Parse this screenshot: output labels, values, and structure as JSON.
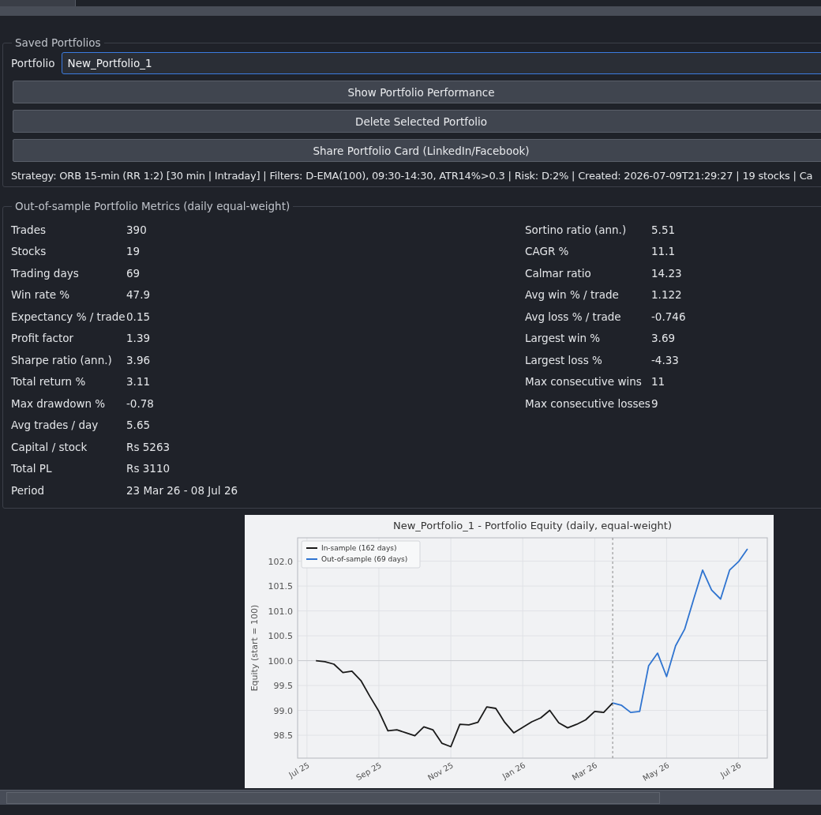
{
  "saved_portfolios": {
    "title": "Saved Portfolios",
    "portfolio_label": "Portfolio",
    "portfolio_value": "New_Portfolio_1",
    "buttons": [
      "Show Portfolio Performance",
      "Delete Selected Portfolio",
      "Share Portfolio Card (LinkedIn/Facebook)"
    ],
    "strategy_line": "Strategy: ORB 15-min (RR 1:2) [30 min | Intraday] | Filters: D-EMA(100), 09:30-14:30, ATR14%>0.3 | Risk: D:2% | Created: 2026-07-09T21:29:27 | 19 stocks | Ca"
  },
  "metrics": {
    "title": "Out-of-sample Portfolio Metrics (daily equal-weight)",
    "left": [
      {
        "label": "Trades",
        "value": "390"
      },
      {
        "label": "Stocks",
        "value": "19"
      },
      {
        "label": "Trading days",
        "value": "69"
      },
      {
        "label": "Win rate %",
        "value": "47.9"
      },
      {
        "label": "Expectancy % / trade",
        "value": "0.15"
      },
      {
        "label": "Profit factor",
        "value": "1.39"
      },
      {
        "label": "Sharpe ratio (ann.)",
        "value": "3.96"
      },
      {
        "label": "Total return %",
        "value": "3.11"
      },
      {
        "label": "Max drawdown %",
        "value": "-0.78"
      },
      {
        "label": "Avg trades / day",
        "value": "5.65"
      },
      {
        "label": "Capital / stock",
        "value": "Rs 5263"
      },
      {
        "label": "Total PL",
        "value": "Rs 3110"
      },
      {
        "label": "Period",
        "value": "23 Mar 26 - 08 Jul 26"
      }
    ],
    "right": [
      {
        "label": "Sortino ratio (ann.)",
        "value": "5.51"
      },
      {
        "label": "CAGR %",
        "value": "11.1"
      },
      {
        "label": "Calmar ratio",
        "value": "14.23"
      },
      {
        "label": "Avg win % / trade",
        "value": "1.122"
      },
      {
        "label": "Avg loss % / trade",
        "value": "-0.746"
      },
      {
        "label": "Largest win %",
        "value": "3.69"
      },
      {
        "label": "Largest loss %",
        "value": "-4.33"
      },
      {
        "label": "Max consecutive wins",
        "value": "11"
      },
      {
        "label": "Max consecutive losses",
        "value": "9"
      }
    ]
  },
  "equity_chart": {
    "chart_data": {
      "type": "line",
      "title": "New_Portfolio_1 - Portfolio Equity (daily, equal-weight)",
      "ylabel": "Equity (start = 100)",
      "grid": true,
      "legend": "upper left",
      "ylim": [
        98.04,
        102.47
      ],
      "categories": [
        "Jul 25",
        null,
        null,
        null,
        null,
        null,
        null,
        null,
        "Sep 25",
        null,
        null,
        null,
        null,
        null,
        null,
        null,
        "Nov 25",
        null,
        null,
        null,
        null,
        null,
        null,
        null,
        "Jan 26",
        null,
        null,
        null,
        null,
        null,
        null,
        null,
        "Mar 26",
        null,
        null,
        null,
        null,
        null,
        null,
        null,
        "May 26",
        null,
        null,
        null,
        null,
        null,
        null,
        null,
        "Jul 26",
        null
      ],
      "yticks": [
        {
          "value": 98.5,
          "label": "98.5"
        },
        {
          "value": 99,
          "label": "99.0"
        },
        {
          "value": 99.5,
          "label": "99.5"
        },
        {
          "value": 100,
          "label": "100.0"
        },
        {
          "value": 100.5,
          "label": "100.5"
        },
        {
          "value": 101,
          "label": "101.0"
        },
        {
          "value": 101.5,
          "label": "101.5"
        },
        {
          "value": 102,
          "label": "102.0"
        }
      ],
      "series": [
        {
          "name": "In-sample (162 days)",
          "color": "#1a1a1a",
          "values": [
            null,
            100.0,
            99.98,
            99.93,
            99.76,
            99.79,
            99.6,
            99.28,
            98.98,
            98.59,
            98.61,
            98.55,
            98.49,
            98.67,
            98.61,
            98.34,
            98.27,
            98.72,
            98.71,
            98.76,
            99.07,
            99.04,
            98.76,
            98.55,
            98.66,
            98.77,
            98.85,
            99.0,
            98.75,
            98.65,
            98.72,
            98.81,
            98.98,
            98.96,
            99.15,
            null,
            null,
            null,
            null,
            null,
            null,
            null,
            null,
            null,
            null,
            null,
            null,
            null,
            null,
            null
          ]
        },
        {
          "name": "Out-of-sample (69 days)",
          "color": "#2f74d0",
          "values": [
            null,
            null,
            null,
            null,
            null,
            null,
            null,
            null,
            null,
            null,
            null,
            null,
            null,
            null,
            null,
            null,
            null,
            null,
            null,
            null,
            null,
            null,
            null,
            null,
            null,
            null,
            null,
            null,
            null,
            null,
            null,
            null,
            null,
            null,
            99.15,
            99.1,
            98.96,
            98.98,
            99.9,
            100.15,
            99.68,
            100.3,
            100.63,
            101.23,
            101.82,
            101.42,
            101.24,
            101.82,
            101.99,
            102.25
          ]
        }
      ],
      "ref_lines": [
        {
          "axis": "y",
          "value": 100
        }
      ]
    }
  }
}
